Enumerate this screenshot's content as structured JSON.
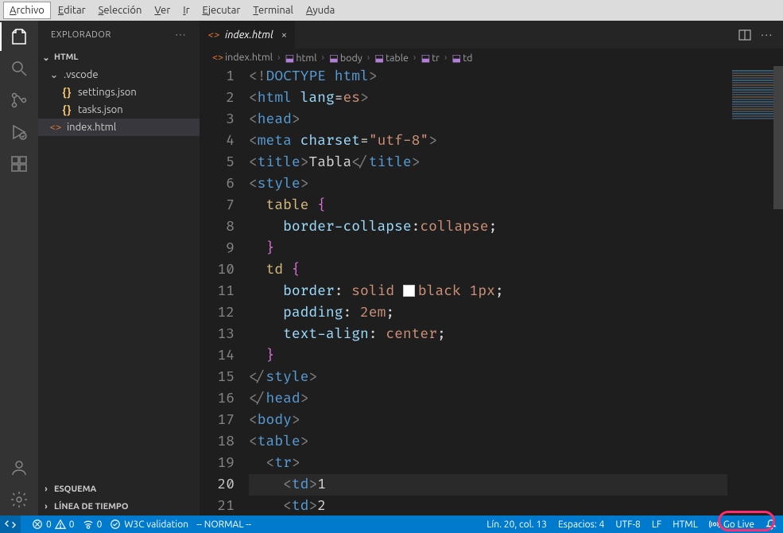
{
  "menubar": {
    "items": [
      {
        "label": "Archivo",
        "mnemonic": 0
      },
      {
        "label": "Editar",
        "mnemonic": 0
      },
      {
        "label": "Selección",
        "mnemonic": 0
      },
      {
        "label": "Ver",
        "mnemonic": 0
      },
      {
        "label": "Ir",
        "mnemonic": 0
      },
      {
        "label": "Ejecutar",
        "mnemonic": 0
      },
      {
        "label": "Terminal",
        "mnemonic": 0
      },
      {
        "label": "Ayuda",
        "mnemonic": 0
      }
    ]
  },
  "sidebar": {
    "title": "EXPLORADOR",
    "root": "HTML",
    "tree": [
      {
        "type": "folder",
        "name": ".vscode",
        "expanded": true,
        "depth": 0
      },
      {
        "type": "file",
        "name": "settings.json",
        "icon": "json",
        "depth": 1
      },
      {
        "type": "file",
        "name": "tasks.json",
        "icon": "json",
        "depth": 1
      },
      {
        "type": "file",
        "name": "index.html",
        "icon": "html",
        "depth": 0,
        "selected": true
      }
    ],
    "sections": [
      {
        "label": "ESQUEMA"
      },
      {
        "label": "LÍNEA DE TIEMPO"
      }
    ]
  },
  "tabs": {
    "open": [
      {
        "label": "index.html",
        "icon": "html",
        "dirty": false,
        "italic": true
      }
    ]
  },
  "breadcrumbs": [
    "index.html",
    "html",
    "body",
    "table",
    "tr",
    "td"
  ],
  "code": {
    "current_line": 20,
    "lines": [
      {
        "n": 1,
        "html": "<span class='tok-bracket'>&lt;!</span><span class='tok-doctype'>DOCTYPE</span> <span class='tok-tag'>html</span><span class='tok-bracket'>&gt;</span>"
      },
      {
        "n": 2,
        "html": "<span class='tok-bracket'>&lt;</span><span class='tok-tag'>html</span> <span class='tok-attr'>lang</span><span class='tok-punc'>=</span><span class='tok-str'>es</span><span class='tok-bracket'>&gt;</span>"
      },
      {
        "n": 3,
        "html": "<span class='tok-bracket'>&lt;</span><span class='tok-tag'>head</span><span class='tok-bracket'>&gt;</span>"
      },
      {
        "n": 4,
        "html": "<span class='tok-bracket'>&lt;</span><span class='tok-tag'>meta</span> <span class='tok-attr'>charset</span><span class='tok-punc'>=</span><span class='tok-str'>\"utf-8\"</span><span class='tok-bracket'>&gt;</span>"
      },
      {
        "n": 5,
        "html": "<span class='tok-bracket'>&lt;</span><span class='tok-tag'>title</span><span class='tok-bracket'>&gt;</span><span class='tok-text'>Tabla</span><span class='tok-bracket'>&lt;/</span><span class='tok-tag'>title</span><span class='tok-bracket'>&gt;</span>"
      },
      {
        "n": 6,
        "html": "<span class='tok-bracket'>&lt;</span><span class='tok-tag'>style</span><span class='tok-bracket'>&gt;</span>"
      },
      {
        "n": 7,
        "html": "  <span class='tok-sel'>table</span> <span class='tok-brace'>{</span>"
      },
      {
        "n": 8,
        "html": "    <span class='tok-prop'>border-collapse</span><span class='tok-punc'>:</span><span class='tok-val'>collapse</span><span class='tok-punc'>;</span>"
      },
      {
        "n": 9,
        "html": "  <span class='tok-brace'>}</span>"
      },
      {
        "n": 10,
        "html": "  <span class='tok-sel'>td</span> <span class='tok-brace'>{</span>"
      },
      {
        "n": 11,
        "html": "    <span class='tok-prop'>border</span><span class='tok-punc'>:</span> <span class='tok-val'>solid</span> <span class='color-swatch'></span><span class='tok-val'>black</span> <span class='tok-val'>1px</span><span class='tok-punc'>;</span>"
      },
      {
        "n": 12,
        "html": "    <span class='tok-prop'>padding</span><span class='tok-punc'>:</span> <span class='tok-val'>2em</span><span class='tok-punc'>;</span>"
      },
      {
        "n": 13,
        "html": "    <span class='tok-prop'>text-align</span><span class='tok-punc'>:</span> <span class='tok-val'>center</span><span class='tok-punc'>;</span>"
      },
      {
        "n": 14,
        "html": "  <span class='tok-brace'>}</span>"
      },
      {
        "n": 15,
        "html": "<span class='tok-bracket'>&lt;/</span><span class='tok-tag'>style</span><span class='tok-bracket'>&gt;</span>"
      },
      {
        "n": 16,
        "html": "<span class='tok-bracket'>&lt;/</span><span class='tok-tag'>head</span><span class='tok-bracket'>&gt;</span>"
      },
      {
        "n": 17,
        "html": "<span class='tok-bracket'>&lt;</span><span class='tok-tag'>body</span><span class='tok-bracket'>&gt;</span>"
      },
      {
        "n": 18,
        "html": "<span class='tok-bracket'>&lt;</span><span class='tok-tag'>table</span><span class='tok-bracket'>&gt;</span>"
      },
      {
        "n": 19,
        "html": "  <span class='tok-bracket'>&lt;</span><span class='tok-tag'>tr</span><span class='tok-bracket'>&gt;</span>"
      },
      {
        "n": 20,
        "html": "    <span class='tok-bracket'>&lt;</span><span class='tok-tag'>td</span><span class='tok-bracket'>&gt;</span><span class='tok-text'>1</span>"
      },
      {
        "n": 21,
        "html": "    <span class='tok-bracket'>&lt;</span><span class='tok-tag'>td</span><span class='tok-bracket'>&gt;</span><span class='tok-text'>2</span>"
      }
    ]
  },
  "statusbar": {
    "errors": "0",
    "warnings": "0",
    "ports": "0",
    "validation": "W3C validation",
    "vim_mode": "-- NORMAL --",
    "position": "Lín. 20, col. 13",
    "spaces": "Espacios: 4",
    "encoding": "UTF-8",
    "eol": "LF",
    "language": "HTML",
    "golive": "Go Live"
  }
}
